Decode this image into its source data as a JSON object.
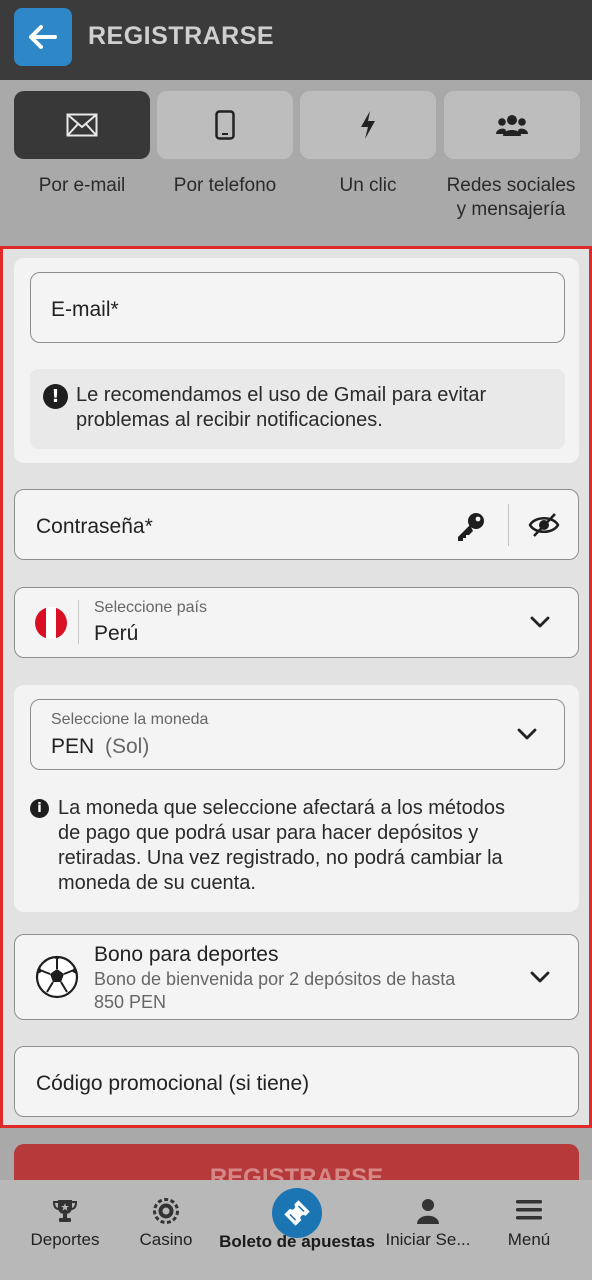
{
  "header": {
    "title": "REGISTRARSE"
  },
  "methods": [
    {
      "label": "Por e-mail",
      "icon": "envelope-icon",
      "active": true
    },
    {
      "label": "Por telefono",
      "icon": "phone-icon",
      "active": false
    },
    {
      "label": "Un clic",
      "icon": "lightning-icon",
      "active": false
    },
    {
      "label_line1": "Redes sociales",
      "label_line2": "y mensajería",
      "icon": "users-icon",
      "active": false
    }
  ],
  "form": {
    "email_placeholder": "E-mail*",
    "gmail_notice_line1": "Le recomendamos el uso de Gmail para evitar",
    "gmail_notice_line2": "problemas al recibir notificaciones.",
    "password_placeholder": "Contraseña*",
    "country_label": "Seleccione país",
    "country_value": "Perú",
    "currency_label": "Seleccione la moneda",
    "currency_code": "PEN",
    "currency_name": "(Sol)",
    "currency_notice_line1": "La moneda que seleccione afectará a los métodos",
    "currency_notice_line2": "de pago que podrá usar para hacer depósitos y",
    "currency_notice_line3": "retiradas. Una vez registrado, no podrá cambiar la",
    "currency_notice_line4": "moneda de su cuenta.",
    "bonus_title": "Bono para deportes",
    "bonus_desc_line1": "Bono de bienvenida por 2 depósitos de hasta",
    "bonus_desc_line2": "850 PEN",
    "promo_placeholder": "Código promocional (si tiene)"
  },
  "register_button": {
    "label": "REGISTRARSE"
  },
  "bottom_nav": [
    {
      "label": "Deportes",
      "icon": "trophy-icon"
    },
    {
      "label": "Casino",
      "icon": "casino-chip-icon"
    },
    {
      "label": "Boleto de apuestas",
      "icon": "ticket-icon"
    },
    {
      "label": "Iniciar Se...",
      "icon": "user-icon"
    },
    {
      "label": "Menú",
      "icon": "hamburger-menu-icon"
    }
  ],
  "colors": {
    "accent_blue": "#2e88c8",
    "highlight_red": "#e02a2a",
    "register_red": "#b73a3a"
  }
}
